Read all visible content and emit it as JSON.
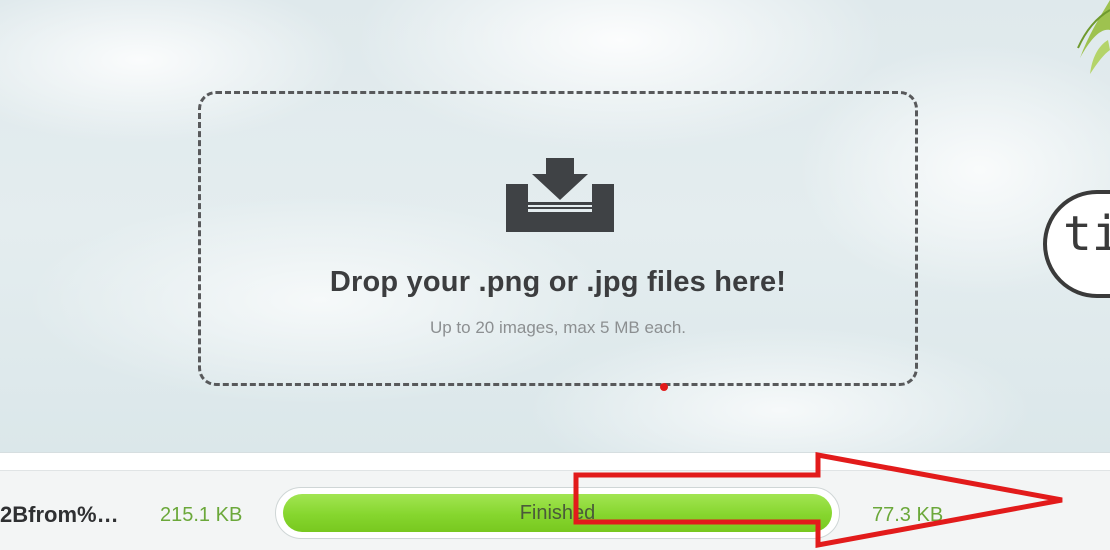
{
  "dropzone": {
    "title": "Drop your .png or .jpg files here!",
    "subtitle": "Up to 20 images, max 5 MB each."
  },
  "badge": {
    "text": "ti"
  },
  "file_row": {
    "file_name": "2Bfrom%…",
    "original_size": "215.1 KB",
    "status": "Finished",
    "progress_percent": 100,
    "compressed_size": "77.3 KB"
  },
  "colors": {
    "progress_green": "#86d62e",
    "size_green": "#6ba83a",
    "annotation_red": "#e21b1b",
    "dashed_border": "#58595b"
  },
  "icons": {
    "drop": "download-tray-icon",
    "leaf": "bamboo-leaf-icon"
  }
}
